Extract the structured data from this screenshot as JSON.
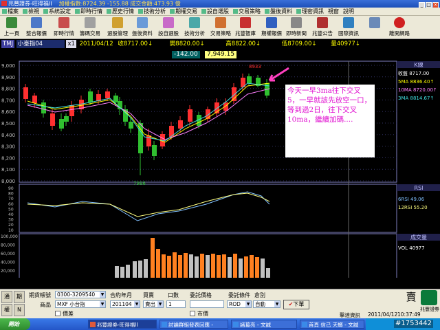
{
  "window": {
    "title": "兆豐證券-旺得福II",
    "ticker": "加權指數:8724.39   -155.88 成交金額:473.93    億"
  },
  "menu": [
    "檔案",
    "檢視",
    "系統設定",
    "即時行情",
    "歷史行情",
    "技術分析",
    "期權交易",
    "設自選股",
    "交易策略",
    "盤後資料",
    "理密資訊",
    "視窗",
    "說明"
  ],
  "toolbar": [
    "上一頁",
    "整合報價",
    "即時行情",
    "籌碼交易",
    "選股管理",
    "盤後資料",
    "設自選股",
    "技術分析",
    "交易策略",
    "兆豐智庫",
    "期權報價",
    "即時新聞",
    "兆豐公告",
    "國際資訊",
    "",
    "離開網路"
  ],
  "quote": {
    "symbol": "TMJ",
    "product": "小臺指04",
    "period": "x1",
    "date": "2011/04/12",
    "close": "收8717.00↓",
    "open": "開8820.00↓",
    "high": "高8822.00↓",
    "low": "低8709.00↓",
    "volume": "量40977↓",
    "change": "-142.00",
    "last": "7,949.15"
  },
  "chart": {
    "price_ticks": [
      "9,000",
      "8,900",
      "8,800",
      "8,700",
      "8,600",
      "8,500",
      "8,400",
      "8,300",
      "8,200",
      "8,100",
      "8,000"
    ],
    "high_label": "8933",
    "low_label": "7986",
    "rsi_ticks": [
      "90",
      "80",
      "70",
      "60",
      "50",
      "40",
      "30",
      "20",
      "10"
    ],
    "vol_ticks": [
      "100,000",
      "80,000",
      "60,000",
      "40,000",
      "20,000"
    ],
    "x_labels": [
      "2011",
      "2",
      "3",
      "4"
    ],
    "ma_panel_title": "K線",
    "ma_legend": [
      "收盤 8717.00",
      "5MA 8836.40↑",
      "10MA 8720.00↑",
      "3MA 8814.67↑"
    ],
    "rsi_title": "RSI",
    "rsi_legend": [
      "6RSI 49.06",
      "12RSI 55.20"
    ],
    "vol_title": "成交量",
    "vol_legend": "VOL 40977",
    "annotation": "今天一早3ma往下交叉5，一早就該先放空一口，等到過2日，往下交叉10ma，繼續加碼...."
  },
  "order": {
    "left_btns": [
      "通",
      "期",
      "權",
      "N"
    ],
    "account_label": "期貨帳號",
    "account_value": "0300-3209540",
    "product_label": "商品",
    "product_value": "MXF 小台指",
    "month_label": "合約年月",
    "month_value": "201104",
    "side_label": "買賣",
    "side_value": "賣出",
    "qty_label": "口數",
    "qty_value": "1",
    "price_label": "委託價格",
    "cond_label": "委託條件",
    "cond_value": "ROD",
    "open_label": "倉別",
    "open_value": "自動",
    "spread_label": "價差",
    "market_label": "市價",
    "submit": "下單",
    "big_btn": "賣",
    "status": "擊達資訊",
    "status_date": "2011/04/12",
    "status_time": "10:37:49",
    "brand": "兆豐證券"
  },
  "taskbar": {
    "start": "開始",
    "items": [
      "兆豐證券-旺得福II",
      "討論群組發表回應 -",
      "諸葛亮 - 文誠",
      "首頁 信己 天螂 - 文誠"
    ],
    "watermark": "#1753442"
  }
}
